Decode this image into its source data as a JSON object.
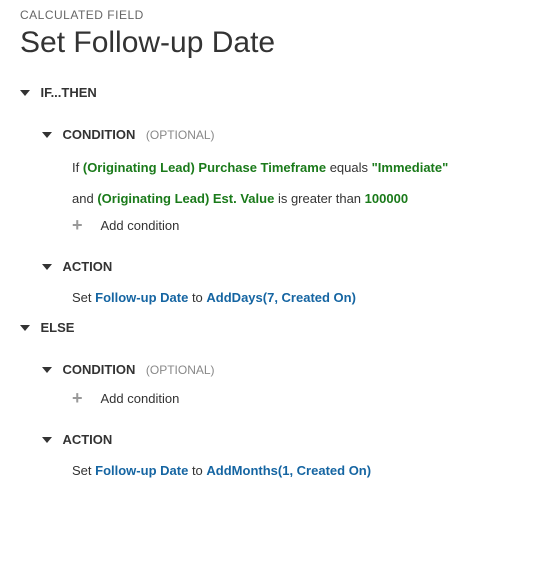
{
  "breadcrumb": "CALCULATED FIELD",
  "title": "Set Follow-up Date",
  "ifthen": {
    "label": "IF...THEN",
    "condition": {
      "label": "CONDITION",
      "optional": "(OPTIONAL)",
      "line1": {
        "prefix": "If",
        "field": "(Originating Lead) Purchase Timeframe",
        "op": "equals",
        "value": "\"Immediate\""
      },
      "line2": {
        "prefix": "and",
        "field": "(Originating Lead) Est. Value",
        "op": "is greater than",
        "value": "100000"
      },
      "add_label": "Add condition"
    },
    "action": {
      "label": "ACTION",
      "set_text": "Set",
      "field": "Follow-up Date",
      "to_text": "to",
      "func": "AddDays(7, Created On)"
    }
  },
  "else": {
    "label": "ELSE",
    "condition": {
      "label": "CONDITION",
      "optional": "(OPTIONAL)",
      "add_label": "Add condition"
    },
    "action": {
      "label": "ACTION",
      "set_text": "Set",
      "field": "Follow-up Date",
      "to_text": "to",
      "func": "AddMonths(1, Created On)"
    }
  }
}
